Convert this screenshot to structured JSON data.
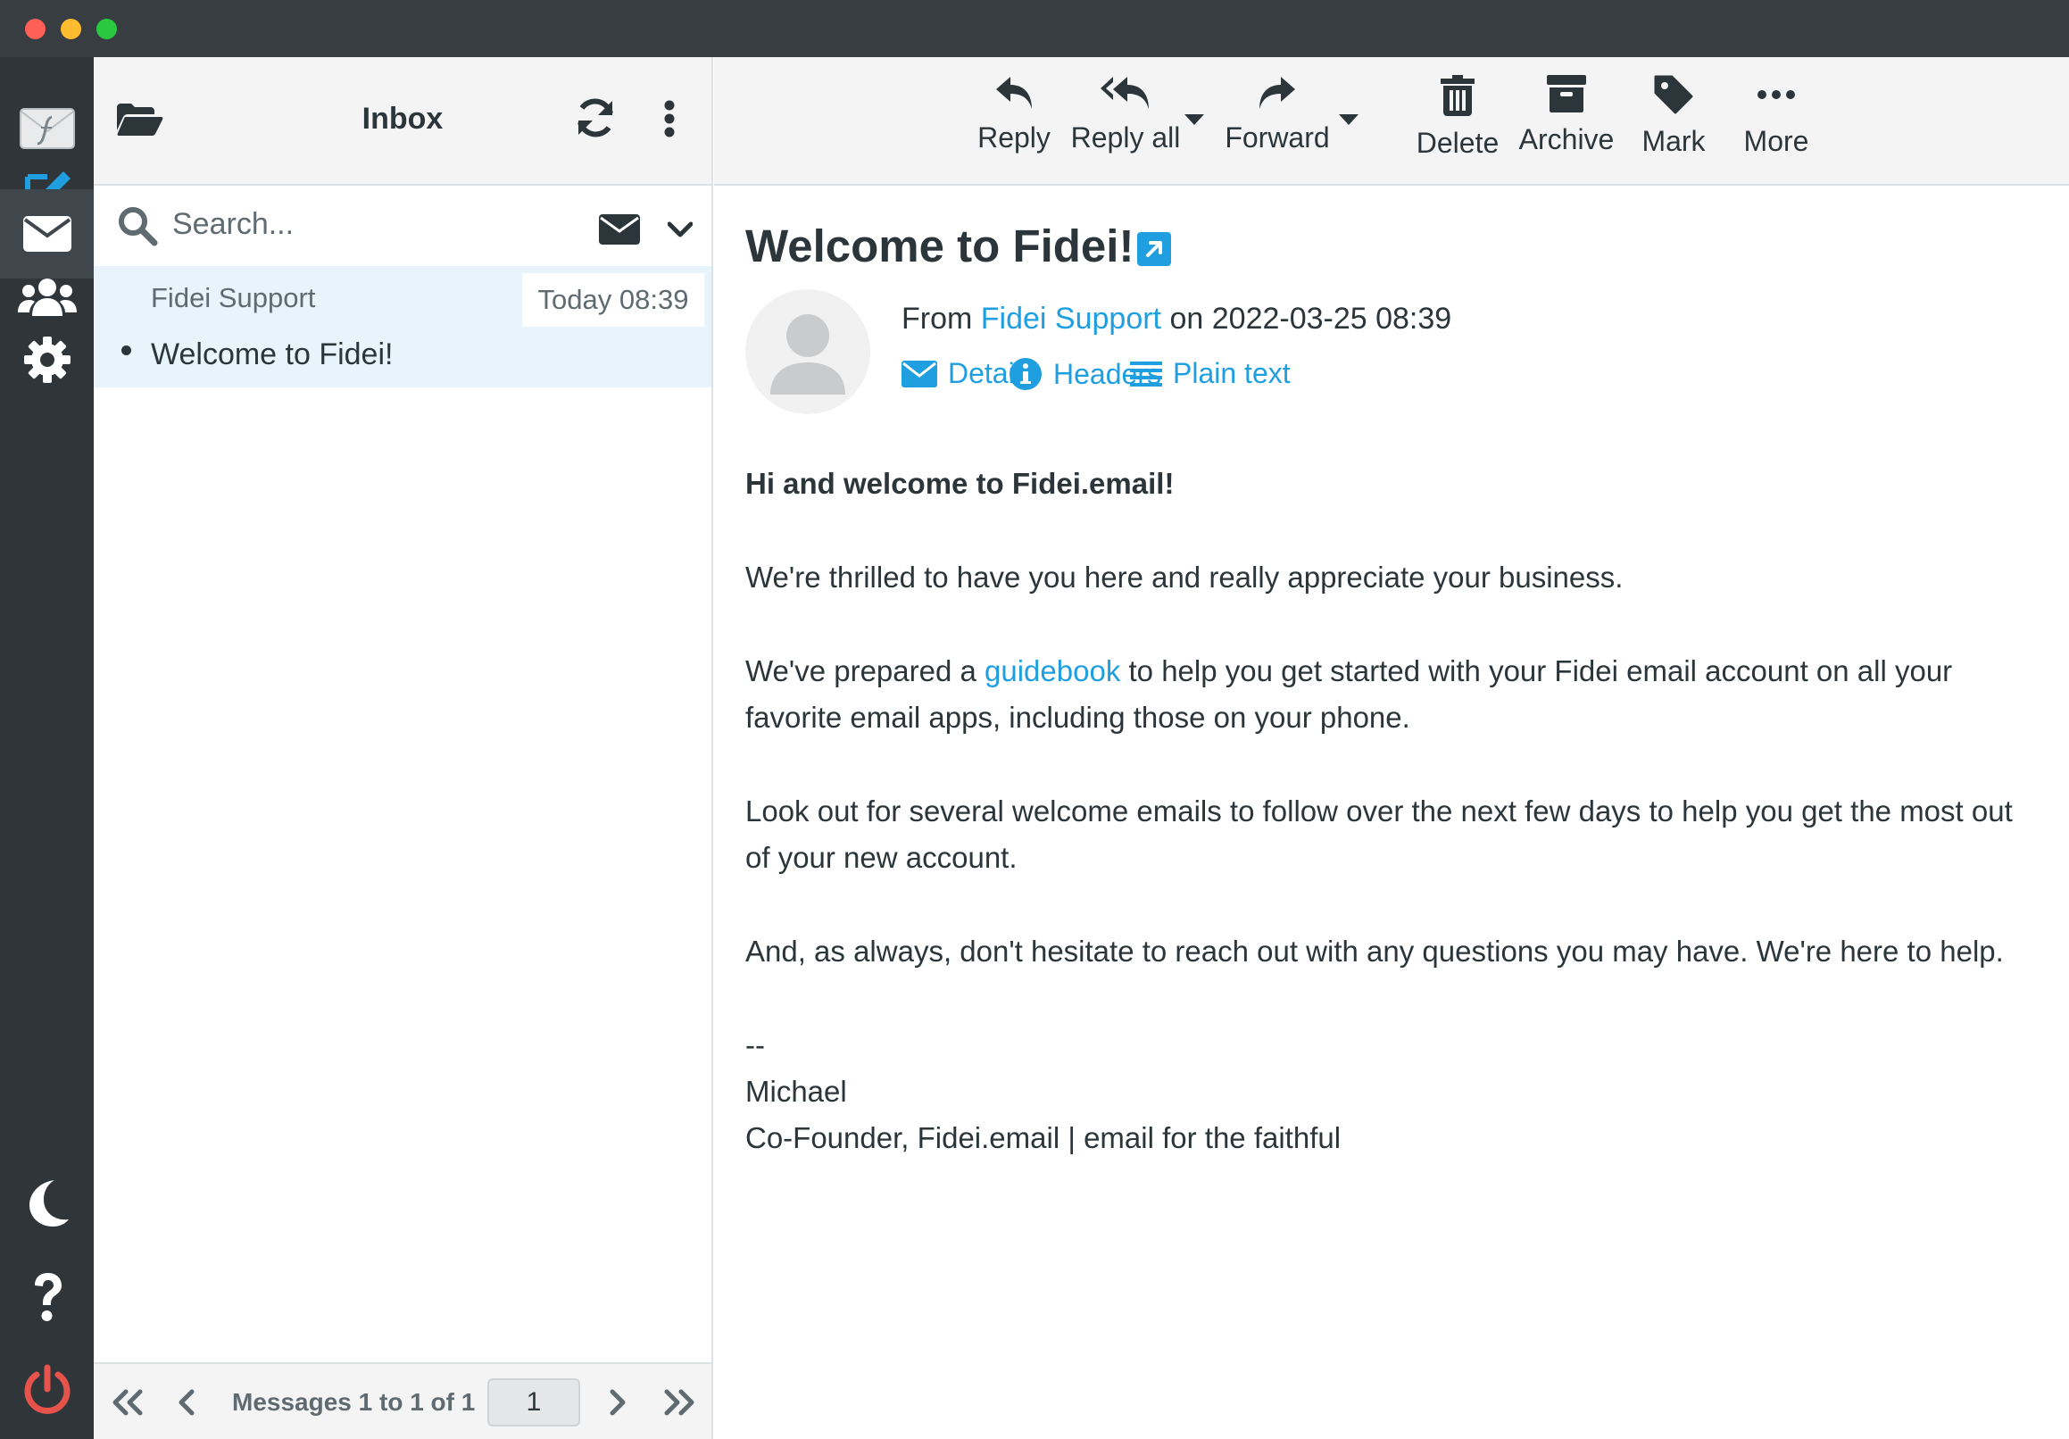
{
  "window": {
    "traffic_lights": [
      "close",
      "minimize",
      "maximize"
    ]
  },
  "sidebar": {
    "items": [
      {
        "name": "logo",
        "icon": "envelope-logo-icon"
      },
      {
        "name": "compose",
        "icon": "compose-icon"
      },
      {
        "name": "mail",
        "icon": "envelope-icon",
        "active": true
      },
      {
        "name": "contacts",
        "icon": "users-icon"
      },
      {
        "name": "settings",
        "icon": "gear-icon"
      },
      {
        "name": "night-mode",
        "icon": "moon-icon"
      },
      {
        "name": "help",
        "icon": "question-icon"
      },
      {
        "name": "logout",
        "icon": "power-icon"
      }
    ]
  },
  "list": {
    "title": "Inbox",
    "search_placeholder": "Search...",
    "messages": [
      {
        "from": "Fidei Support",
        "date": "Today 08:39",
        "subject": "Welcome to Fidei!",
        "unread": true
      }
    ],
    "pager": {
      "text": "Messages 1 to 1 of 1",
      "page": "1"
    }
  },
  "toolbar": {
    "reply": "Reply",
    "reply_all": "Reply all",
    "forward": "Forward",
    "delete": "Delete",
    "archive": "Archive",
    "mark": "Mark",
    "more": "More"
  },
  "message": {
    "subject": "Welcome to Fidei!",
    "from_prefix": "From",
    "from_name": "Fidei Support",
    "date_prefix": "on",
    "date": "2022-03-25 08:39",
    "links": {
      "details": "Details",
      "headers": "Headers",
      "plain_text": "Plain text"
    },
    "body": {
      "greeting": "Hi and welcome to Fidei.email!",
      "p1": "We're thrilled to have you here and really appreciate your business.",
      "p2_before": "We've prepared a",
      "p2_link": "guidebook",
      "p2_after": "to help you get started with your Fidei email account on all your favorite email apps, including those on your phone.",
      "p3": "Look out for several welcome emails to follow over the next few days to help you get the most out of your new account.",
      "p4": "And, as always, don't hesitate to reach out with any questions you may have. We're here to help.",
      "sig_dash": "--",
      "sig_name": "Michael",
      "sig_title": "Co-Founder, Fidei.email | email for the faithful"
    }
  },
  "colors": {
    "accent": "#1f9fe0",
    "sidebar_bg": "#2f3539",
    "logout": "#e5534b",
    "selected_row": "#e7f4fb"
  }
}
